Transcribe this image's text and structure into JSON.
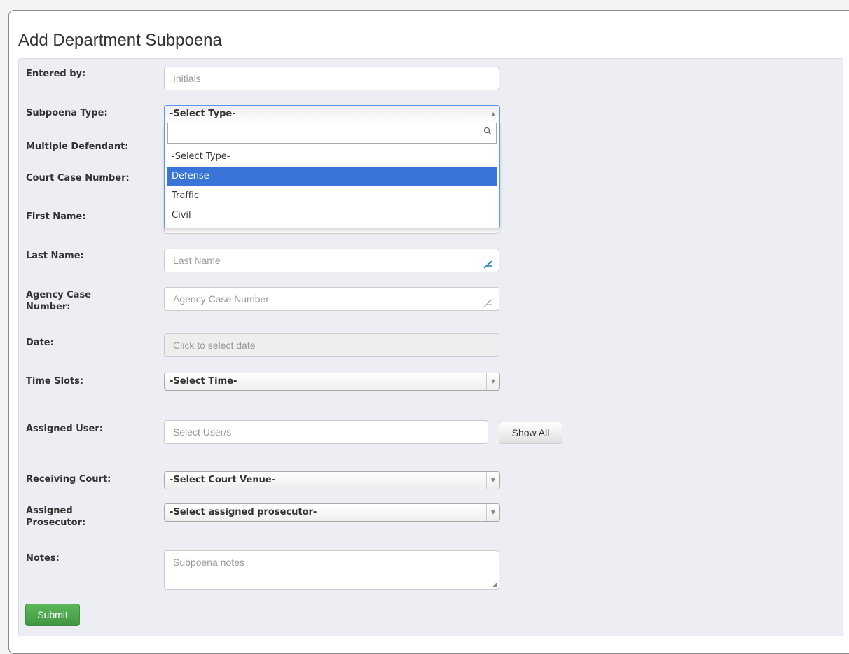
{
  "page": {
    "title": "Add Department Subpoena"
  },
  "labels": {
    "entered_by": "Entered by:",
    "subpoena_type": "Subpoena Type:",
    "multiple_defendant": "Multiple Defendant:",
    "court_case_number": "Court Case Number:",
    "first_name": "First Name:",
    "last_name": "Last Name:",
    "agency_case_number_l1": "Agency Case",
    "agency_case_number_l2": "Number:",
    "date": "Date:",
    "time_slots": "Time Slots:",
    "assigned_user": "Assigned User:",
    "receiving_court": "Receiving Court:",
    "assigned_prosecutor_l1": "Assigned",
    "assigned_prosecutor_l2": "Prosecutor:",
    "notes": "Notes:"
  },
  "fields": {
    "entered_by_placeholder": "Initials",
    "last_name_placeholder": "Last Name",
    "agency_case_number_placeholder": "Agency Case Number",
    "date_placeholder": "Click to select date",
    "assigned_user_placeholder": "Select User/s",
    "notes_placeholder": "Subpoena notes"
  },
  "selects": {
    "subpoena_type_value": "-Select Type-",
    "time_slots_value": "-Select Time-",
    "receiving_court_value": "-Select Court Venue-",
    "assigned_prosecutor_value": "-Select assigned prosecutor-"
  },
  "dropdown": {
    "search_value": "",
    "options": [
      "-Select Type-",
      "Defense",
      "Traffic",
      "Civil"
    ],
    "highlighted": "Defense"
  },
  "buttons": {
    "show_all": "Show All",
    "submit": "Submit"
  },
  "icons": {
    "search": "search-icon",
    "feather": "feather-icon",
    "caret": "caret-icon",
    "resize": "resize-grip-icon"
  },
  "colors": {
    "highlight": "#3875d7",
    "submit": "#4cae4c",
    "well": "#eceef3"
  }
}
